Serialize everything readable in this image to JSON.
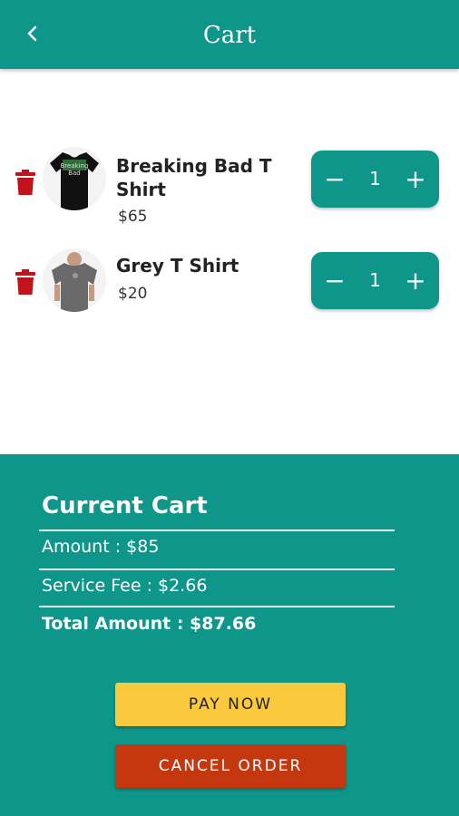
{
  "appbar": {
    "title": "Cart",
    "back_icon": "chevron-left-icon"
  },
  "cart": {
    "items": [
      {
        "name": "Breaking Bad T Shirt",
        "price": "$65",
        "quantity": "1",
        "image": "black-tshirt-image"
      },
      {
        "name": "Grey T Shirt",
        "price": "$20",
        "quantity": "1",
        "image": "grey-tshirt-image"
      }
    ],
    "stepper": {
      "minus": "−",
      "plus": "+"
    }
  },
  "summary": {
    "title": "Current Cart",
    "amount": "Amount : $85",
    "service_fee": "Service Fee : $2.66",
    "total": "Total Amount : $87.66"
  },
  "actions": {
    "pay": "PAY NOW",
    "cancel": "CANCEL ORDER"
  },
  "colors": {
    "primary": "#0f968a",
    "pay": "#fbc93e",
    "cancel": "#c4370f",
    "trash": "#c0131b"
  }
}
